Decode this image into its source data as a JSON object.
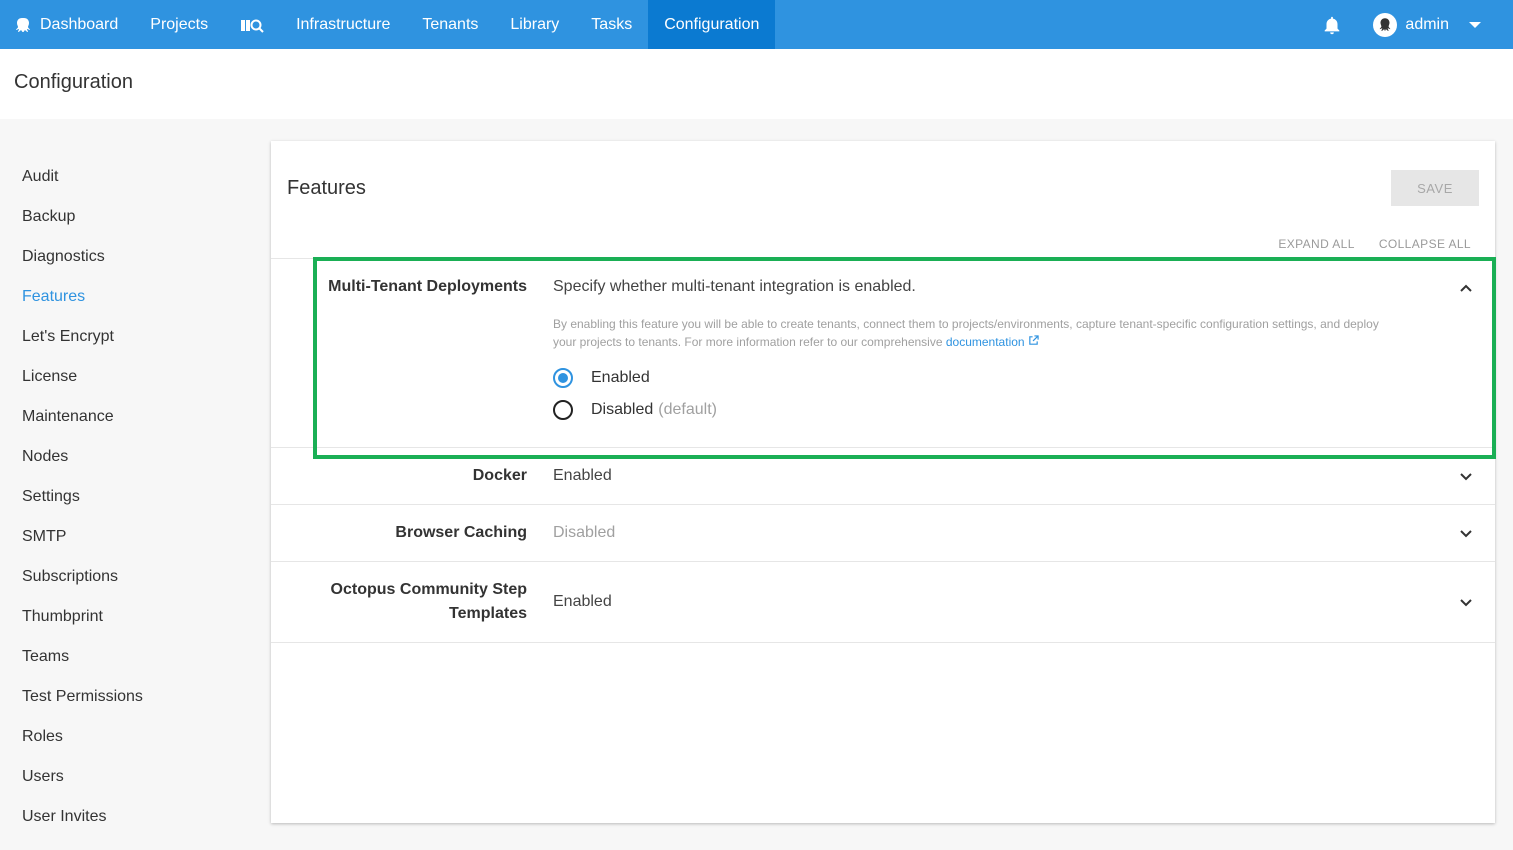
{
  "nav": {
    "items": [
      {
        "label": "Dashboard",
        "icon": "octopus-logo-icon"
      },
      {
        "label": "Projects"
      },
      {
        "label": "",
        "icon": "library-search-icon"
      },
      {
        "label": "Infrastructure"
      },
      {
        "label": "Tenants"
      },
      {
        "label": "Library"
      },
      {
        "label": "Tasks"
      },
      {
        "label": "Configuration",
        "active": true
      }
    ],
    "user": "admin",
    "accent_color": "#2f93e0"
  },
  "page": {
    "title": "Configuration"
  },
  "sidebar": {
    "items": [
      {
        "label": "Audit"
      },
      {
        "label": "Backup"
      },
      {
        "label": "Diagnostics"
      },
      {
        "label": "Features"
      },
      {
        "label": "Let's Encrypt"
      },
      {
        "label": "License"
      },
      {
        "label": "Maintenance"
      },
      {
        "label": "Nodes"
      },
      {
        "label": "Settings"
      },
      {
        "label": "SMTP"
      },
      {
        "label": "Subscriptions"
      },
      {
        "label": "Thumbprint"
      },
      {
        "label": "Teams"
      },
      {
        "label": "Test Permissions"
      },
      {
        "label": "Roles"
      },
      {
        "label": "Users"
      },
      {
        "label": "User Invites"
      }
    ],
    "active": "Features"
  },
  "panel": {
    "title": "Features",
    "save_label": "SAVE",
    "expand_all": "EXPAND ALL",
    "collapse_all": "COLLAPSE ALL",
    "sections": [
      {
        "label": "Multi-Tenant Deployments",
        "summary": "Specify whether multi-tenant integration is enabled.",
        "help_line1": "By enabling this feature you will be able to create tenants, connect them to projects/environments, capture tenant-specific configuration settings, and deploy",
        "help_line2": "your projects to tenants. For more information refer to our comprehensive",
        "help_link": "documentation",
        "options": [
          {
            "label": "Enabled",
            "note": "",
            "selected": true
          },
          {
            "label": "Disabled",
            "note": "(default)",
            "selected": false
          }
        ],
        "expanded": true
      },
      {
        "label": "Docker",
        "summary": "Enabled"
      },
      {
        "label": "Browser Caching",
        "summary": "Disabled"
      },
      {
        "label": "Octopus Community Step Templates",
        "summary": "Enabled"
      }
    ]
  },
  "highlight_color": "#1aaf55"
}
